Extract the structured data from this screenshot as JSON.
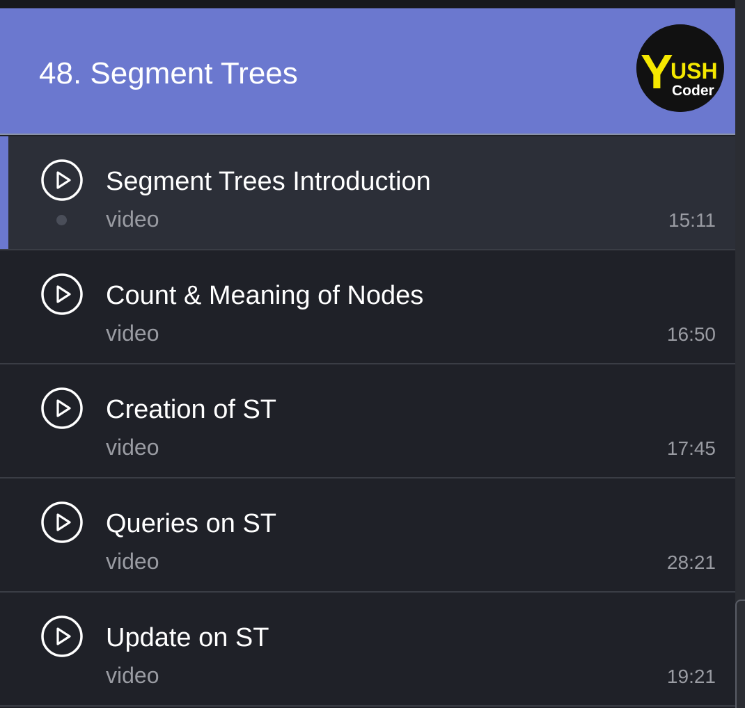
{
  "section": {
    "title": "48. Segment Trees",
    "logo_text_main": "USH",
    "logo_text_sub": "Coder",
    "logo_text_initial": "Y"
  },
  "lessons": [
    {
      "title": "Segment Trees Introduction",
      "type": "video",
      "duration": "15:11",
      "active": true
    },
    {
      "title": "Count & Meaning of Nodes",
      "type": "video",
      "duration": "16:50",
      "active": false
    },
    {
      "title": "Creation of ST",
      "type": "video",
      "duration": "17:45",
      "active": false
    },
    {
      "title": "Queries on ST",
      "type": "video",
      "duration": "28:21",
      "active": false
    },
    {
      "title": "Update on ST",
      "type": "video",
      "duration": "19:21",
      "active": false
    }
  ],
  "icons": {
    "play": "play-circle-icon"
  },
  "colors": {
    "header_bg": "#6b78cf",
    "active_row_bg": "#2c2f38",
    "row_bg": "#1f2128",
    "logo_yellow": "#f5e800"
  }
}
